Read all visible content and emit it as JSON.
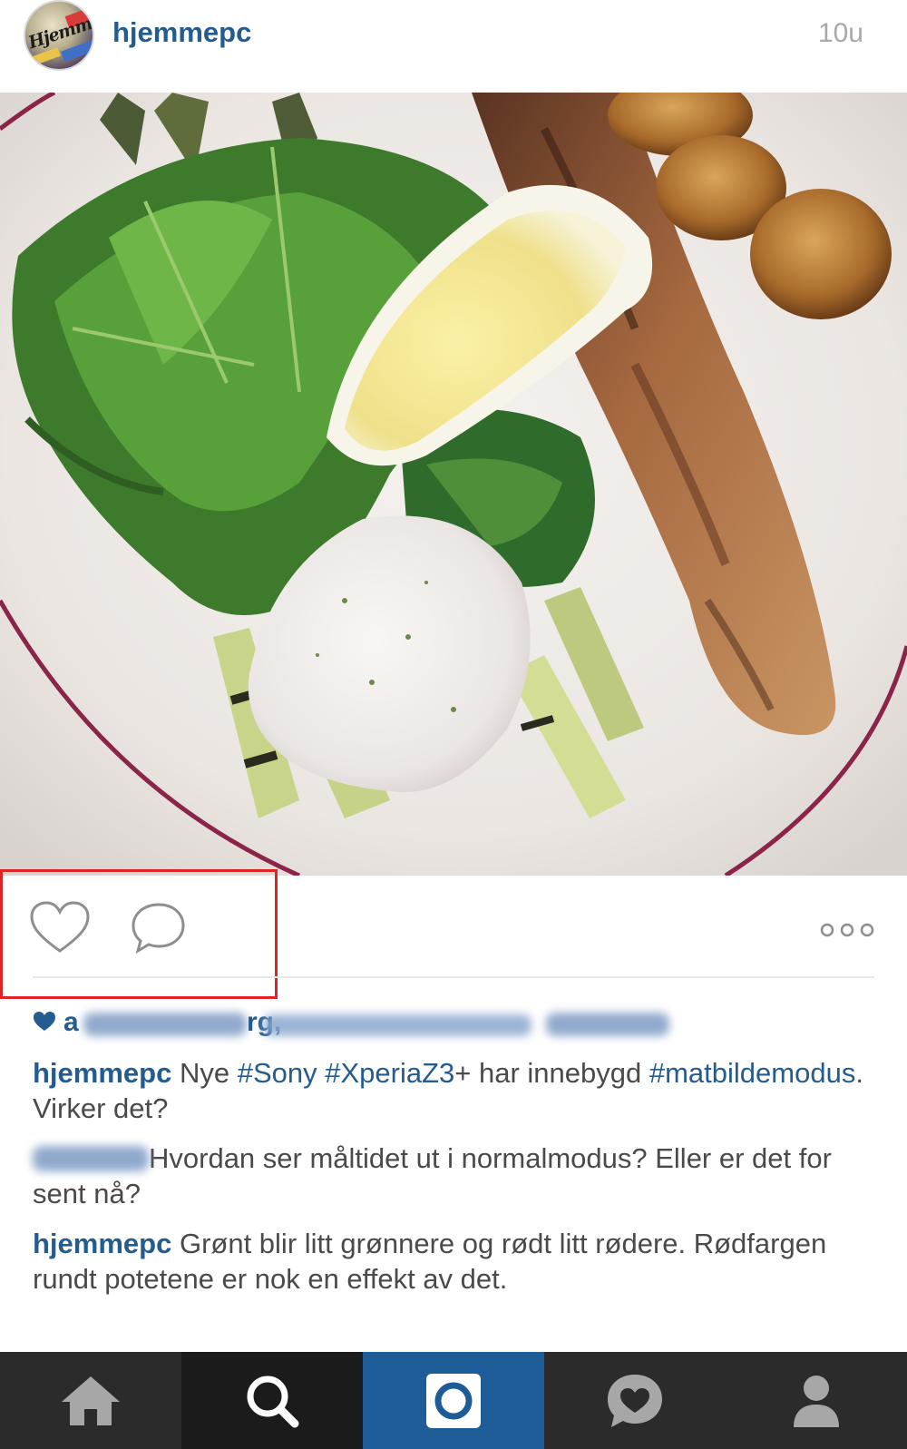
{
  "post": {
    "username": "hjemmepc",
    "time_ago": "10u",
    "avatar_logo_text": "Hjemme"
  },
  "likes": {
    "visible_prefix": "a",
    "visible_suffix": "rg,",
    "icon": "heart-filled-icon"
  },
  "comments": [
    {
      "user": "hjemmepc",
      "parts": [
        {
          "text": "Nye ",
          "type": "text"
        },
        {
          "text": "#Sony",
          "type": "tag"
        },
        {
          "text": " ",
          "type": "text"
        },
        {
          "text": "#XperiaZ3",
          "type": "tag"
        },
        {
          "text": "+ har innebygd ",
          "type": "text"
        },
        {
          "text": "#matbildemodus",
          "type": "tag"
        },
        {
          "text": ". Virker det?",
          "type": "text"
        }
      ]
    },
    {
      "user": "",
      "text": "Hvordan ser måltidet ut i normalmodus? Eller er det for sent nå?"
    },
    {
      "user": "hjemmepc",
      "text": "Grønt blir litt grønnere og rødt litt rødere. Rødfargen rundt potetene er nok en effekt av det."
    }
  ],
  "actions": {
    "like_icon": "heart-outline-icon",
    "comment_icon": "speech-bubble-icon",
    "more_icon": "ellipsis-icon"
  },
  "nav": {
    "items": [
      "home-icon",
      "search-icon",
      "camera-icon",
      "activity-icon",
      "profile-icon"
    ],
    "active": "camera-icon",
    "active_color": "#1d5c96"
  },
  "colors": {
    "link": "#245c8f",
    "text": "#4a4a4a",
    "timestamp": "#a8a8a8",
    "highlight": "#e02424",
    "nav_bg": "#2b2b2b"
  }
}
